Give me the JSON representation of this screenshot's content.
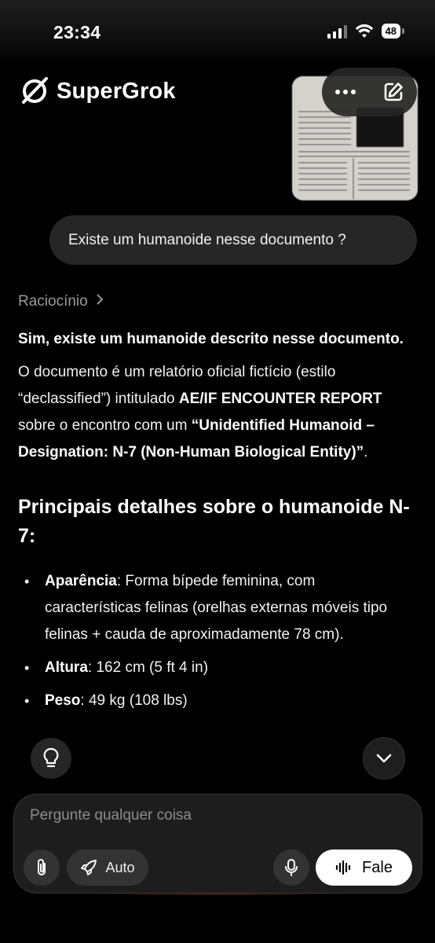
{
  "status_bar": {
    "time": "23:34",
    "battery": "48"
  },
  "header": {
    "app_name": "SuperGrok"
  },
  "conversation": {
    "user_message": "Existe um humanoide nesse documento ?",
    "reasoning_label": "Raciocínio",
    "answer": {
      "lead": "Sim, existe um humanoide descrito nesse documento.",
      "p1_part1": "O documento é um relatório oficial fictício (estilo “declassified”) intitulado ",
      "p1_bold1": "AE/IF ENCOUNTER REPORT",
      "p1_part2": " sobre o encontro com um ",
      "p1_bold2": "“Unidentified Humanoid – Designation: N-7 (Non-Human Biological Entity)”",
      "p1_part3": ".",
      "section_title": "Principais detalhes sobre o humanoide N-7:",
      "bullets": [
        {
          "label": "Aparência",
          "text": ": Forma bípede feminina, com características felinas (orelhas externas móveis tipo felinas + cauda de aproximadamente 78 cm)."
        },
        {
          "label": "Altura",
          "text": ": 162 cm (5 ft 4 in)"
        },
        {
          "label": "Peso",
          "text": ": 49 kg (108 lbs)"
        }
      ]
    }
  },
  "composer": {
    "placeholder": "Pergunte qualquer coisa",
    "auto_label": "Auto",
    "speak_label": "Fale"
  }
}
